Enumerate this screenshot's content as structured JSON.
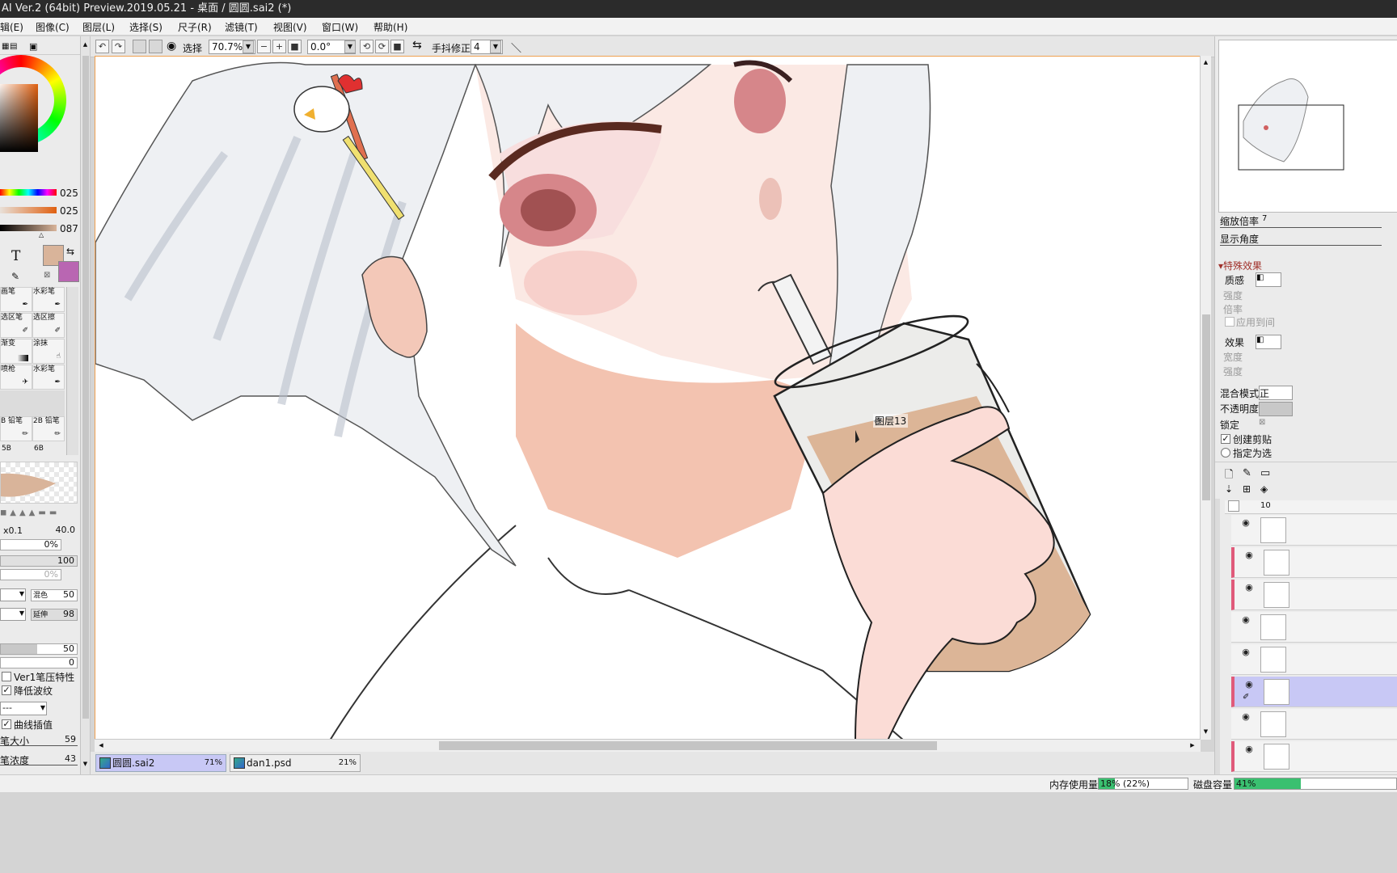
{
  "window": {
    "title": "AI Ver.2 (64bit) Preview.2019.05.21 - 桌面 / 圆圆.sai2 (*)"
  },
  "menu": [
    "辑(E)",
    "图像(C)",
    "图层(L)",
    "选择(S)",
    "尺子(R)",
    "滤镜(T)",
    "视图(V)",
    "窗口(W)",
    "帮助(H)"
  ],
  "toolbar": {
    "select_label": "选择",
    "zoom_value": "70.7%",
    "angle_value": "0.0°",
    "stabilizer_label": "手抖修正",
    "stabilizer_value": "4"
  },
  "left_panel": {
    "color_sliders": [
      "025",
      "025",
      "087"
    ],
    "text_tool_glyph": "T",
    "brushes": [
      {
        "label": "画笔"
      },
      {
        "label": "水彩笔"
      },
      {
        "label": "选区笔"
      },
      {
        "label": "选区擦"
      },
      {
        "label": "渐变"
      },
      {
        "label": "涂抹"
      },
      {
        "label": "喷枪"
      },
      {
        "label": "水彩笔"
      },
      {
        "label": "B 铅笔"
      },
      {
        "label": "2B 铅笔"
      }
    ],
    "brush_bottom": [
      "5B",
      "6B"
    ],
    "size_multiplier": "x0.1",
    "size_value": "40.0",
    "min_size": "0%",
    "density": "100",
    "min_density": "0%",
    "blending_label": "混色",
    "blending_value": "50",
    "persistence_label": "延伸",
    "persistence_value": "98",
    "param_a": "50",
    "param_b": "0",
    "ver1_pressure": "Ver1笔压特性",
    "reduce_moire": "降低波纹",
    "dropdown_value": "---",
    "curve_interp": "曲线插值",
    "pen_size_label": "笔大小",
    "pen_size_value": "59",
    "pen_density_label": "笔浓度",
    "pen_density_value": "43"
  },
  "canvas": {
    "layer_tooltip": "图层13"
  },
  "doc_tabs": [
    {
      "name": "圆圆.sai2",
      "zoom": "71%",
      "active": true
    },
    {
      "name": "dan1.psd",
      "zoom": "21%",
      "active": false
    }
  ],
  "right_panel": {
    "zoom_label": "缩放倍率",
    "zoom_value": "7",
    "angle_label": "显示角度",
    "effects_header": "特殊效果",
    "texture_label": "质感",
    "texture_strength": "强度",
    "texture_scale": "倍率",
    "apply_label": "应用到间",
    "effect_label": "效果",
    "effect_width": "宽度",
    "effect_strength": "强度",
    "blend_mode_label": "混合模式",
    "blend_mode_value": "正",
    "opacity_label": "不透明度",
    "lock_label": "锁定",
    "create_clip": "创建剪贴",
    "assign_sel": "指定为选",
    "layer_count_label": "10"
  },
  "status": {
    "memory_label": "内存使用量",
    "memory_value": "18%",
    "memory_detail": "(22%)",
    "disk_label": "磁盘容量",
    "disk_value": "41%"
  },
  "colors": {
    "canvas_border": "#f0a050",
    "primary_color": "#d9b49a",
    "secondary_color": "#b966b2",
    "selection": "#c8c8f5"
  }
}
